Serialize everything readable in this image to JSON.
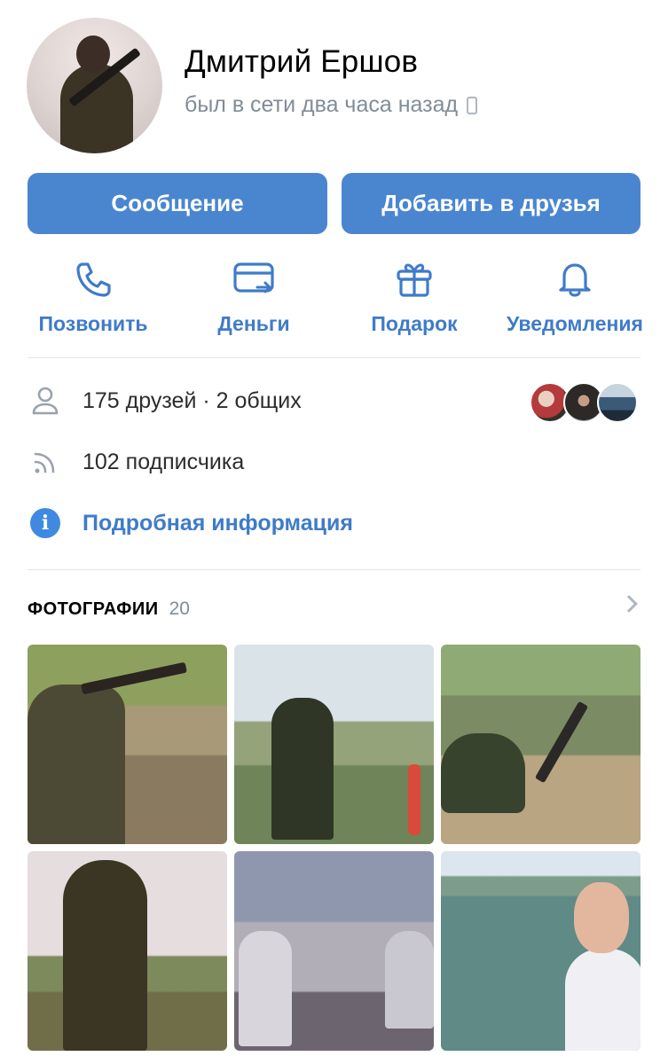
{
  "profile": {
    "name": "Дмитрий Ершов",
    "status": "был в сети два часа назад",
    "status_device_icon": "mobile-phone-icon"
  },
  "buttons": {
    "message": "Сообщение",
    "add_friend": "Добавить в друзья"
  },
  "actions": [
    {
      "label": "Позвонить",
      "icon": "phone-icon"
    },
    {
      "label": "Деньги",
      "icon": "money-card-icon"
    },
    {
      "label": "Подарок",
      "icon": "gift-icon"
    },
    {
      "label": "Уведомления",
      "icon": "bell-icon"
    }
  ],
  "info": {
    "friends": "175 друзей · 2 общих",
    "followers": "102 подписчика",
    "details": "Подробная информация"
  },
  "photos": {
    "title": "ФОТОГРАФИИ",
    "count": "20"
  },
  "colors": {
    "accent": "#4a86d0",
    "link": "#3f7bc9",
    "secondary_text": "#818c99"
  }
}
